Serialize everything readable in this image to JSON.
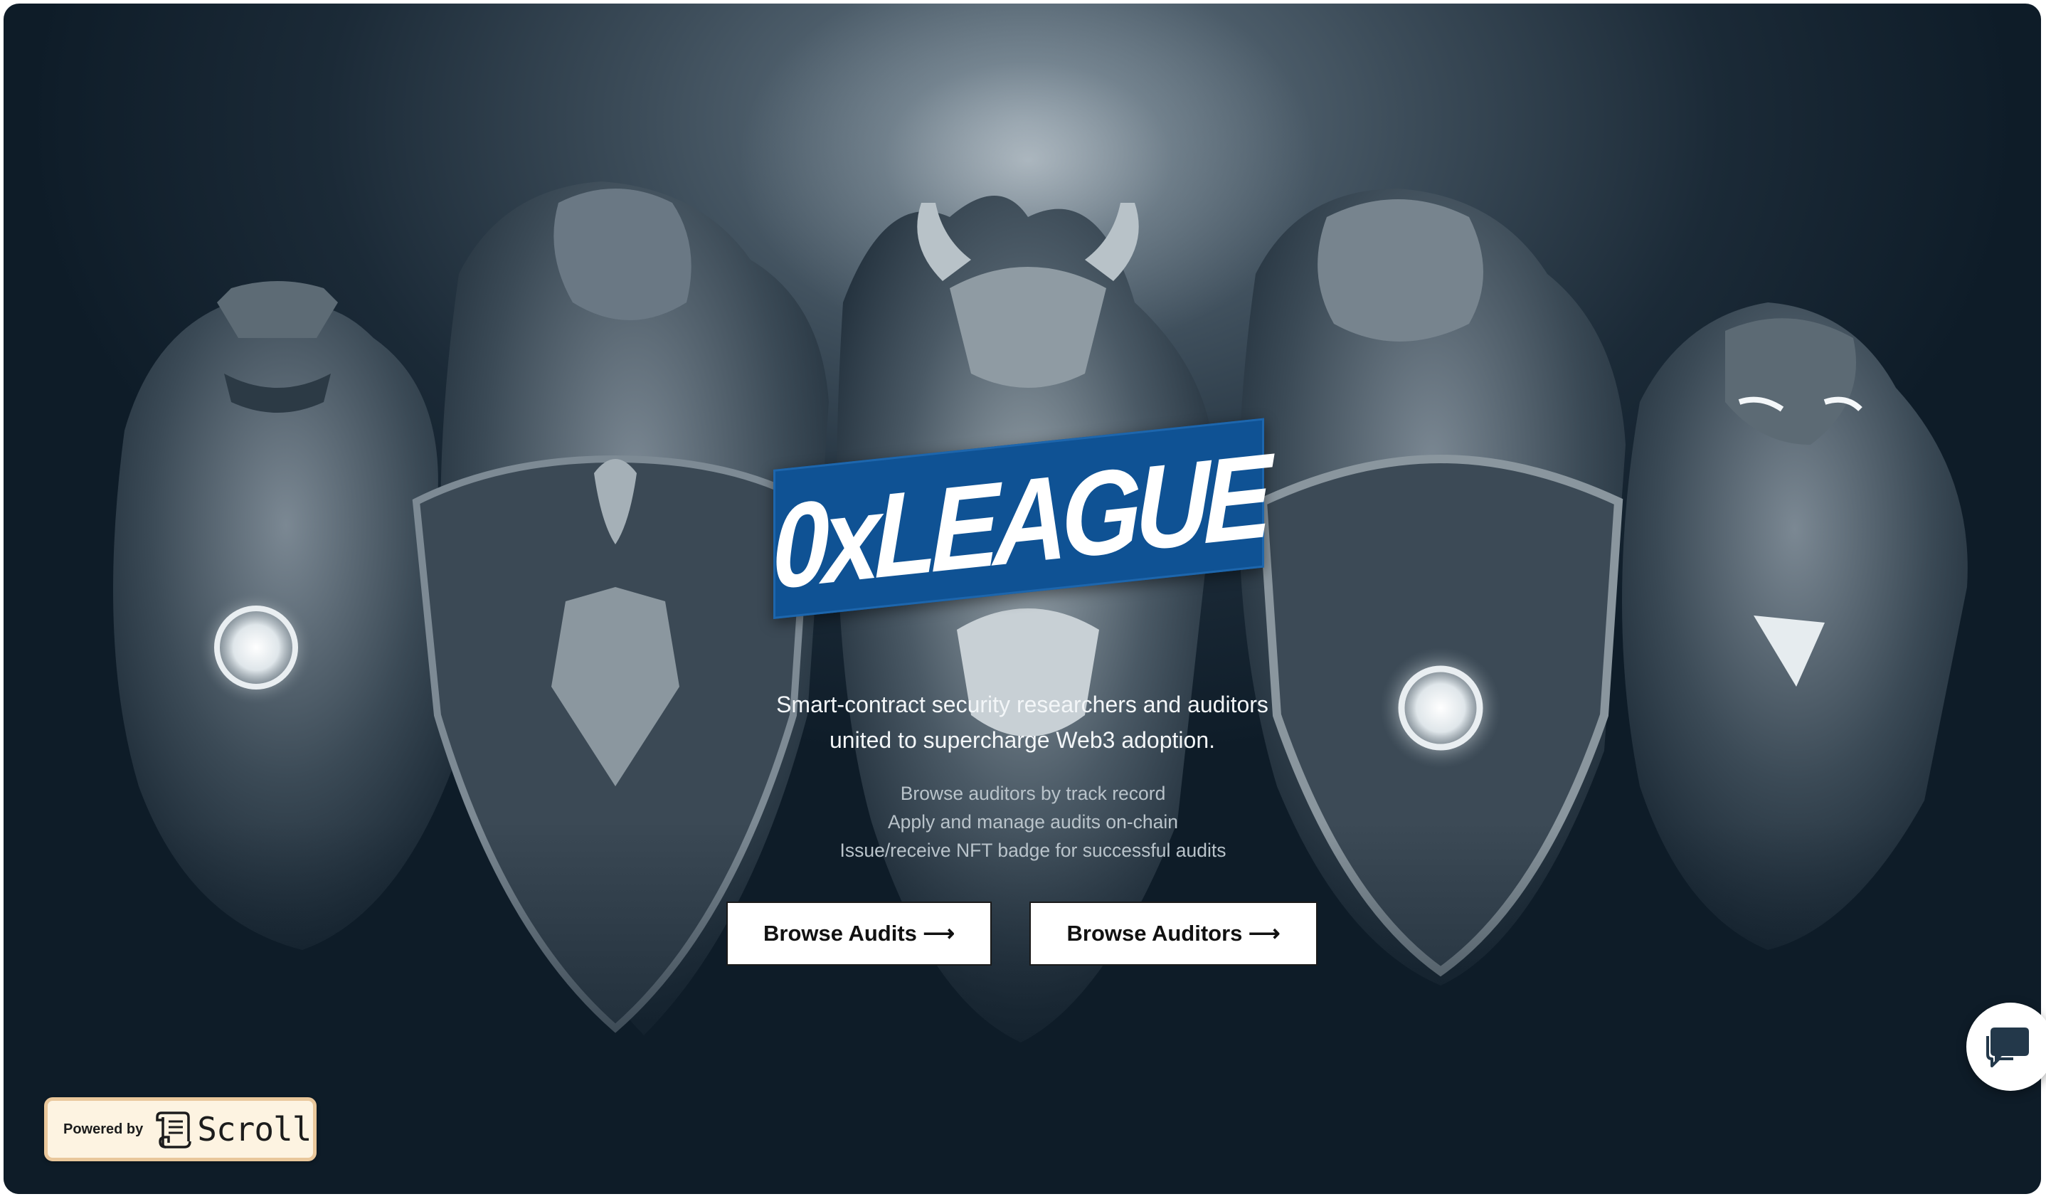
{
  "hero": {
    "logo_text": "0xLEAGUE",
    "tagline_line1": "Smart-contract security researchers and auditors",
    "tagline_line2": "united to supercharge Web3 adoption.",
    "features": [
      "Browse auditors by track record",
      "Apply and manage audits on-chain",
      "Issue/receive NFT badge for successful audits"
    ]
  },
  "actions": {
    "browse_audits_label": "Browse Audits ⟶",
    "browse_auditors_label": "Browse Auditors ⟶"
  },
  "badge": {
    "powered_by": "Powered by",
    "brand": "Scroll",
    "icon": "scroll-icon"
  },
  "chat": {
    "icon": "chat-bubble-icon"
  },
  "colors": {
    "banner_blue": "#0f5294",
    "background_dark": "#0e1c28",
    "badge_bg": "#fdf3e1",
    "badge_border": "#e9c79b"
  }
}
